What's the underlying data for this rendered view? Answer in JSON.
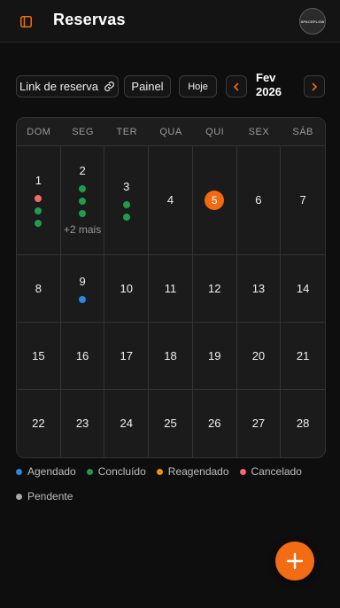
{
  "header": {
    "title": "Reservas",
    "sidebar_icon": "sidebar-toggle-icon",
    "avatar_text": "SPACEFLOW"
  },
  "toolbar": {
    "booking_link_label": "Link de reserva",
    "booking_link_icon": "link-icon",
    "panel_label": "Painel",
    "today_label": "Hoje",
    "prev_icon": "chevron-left-icon",
    "next_icon": "chevron-right-icon",
    "month": "Fev",
    "year": "2026"
  },
  "calendar": {
    "weekdays": [
      "DOM",
      "SEG",
      "TER",
      "QUA",
      "QUI",
      "SEX",
      "SÁB"
    ],
    "today": "5",
    "weeks": [
      [
        {
          "day": "1",
          "events": [
            "cancelado",
            "concluido",
            "concluido"
          ]
        },
        {
          "day": "2",
          "events": [
            "concluido",
            "concluido",
            "concluido"
          ],
          "more": "+2 mais"
        },
        {
          "day": "3",
          "events": [
            "concluido",
            "concluido"
          ]
        },
        {
          "day": "4",
          "events": []
        },
        {
          "day": "5",
          "events": []
        },
        {
          "day": "6",
          "events": []
        },
        {
          "day": "7",
          "events": []
        }
      ],
      [
        {
          "day": "8",
          "events": []
        },
        {
          "day": "9",
          "events": [
            "agendado"
          ]
        },
        {
          "day": "10",
          "events": []
        },
        {
          "day": "11",
          "events": []
        },
        {
          "day": "12",
          "events": []
        },
        {
          "day": "13",
          "events": []
        },
        {
          "day": "14",
          "events": []
        }
      ],
      [
        {
          "day": "15",
          "events": []
        },
        {
          "day": "16",
          "events": []
        },
        {
          "day": "17",
          "events": []
        },
        {
          "day": "18",
          "events": []
        },
        {
          "day": "19",
          "events": []
        },
        {
          "day": "20",
          "events": []
        },
        {
          "day": "21",
          "events": []
        }
      ],
      [
        {
          "day": "22",
          "events": []
        },
        {
          "day": "23",
          "events": []
        },
        {
          "day": "24",
          "events": []
        },
        {
          "day": "25",
          "events": []
        },
        {
          "day": "26",
          "events": []
        },
        {
          "day": "27",
          "events": []
        },
        {
          "day": "28",
          "events": []
        }
      ]
    ]
  },
  "status_colors": {
    "agendado": "#2e86de",
    "concluido": "#1e9e4a",
    "reagendado": "#f0900f",
    "cancelado": "#f26a6a",
    "pendente": "#a8a8a8"
  },
  "legend": [
    {
      "key": "agendado",
      "label": "Agendado"
    },
    {
      "key": "concluido",
      "label": "Concluído"
    },
    {
      "key": "reagendado",
      "label": "Reagendado"
    },
    {
      "key": "cancelado",
      "label": "Cancelado"
    },
    {
      "key": "pendente",
      "label": "Pendente"
    }
  ],
  "fab": {
    "icon": "plus-icon"
  },
  "colors": {
    "accent": "#f36b12",
    "background": "#0e0e0e"
  }
}
